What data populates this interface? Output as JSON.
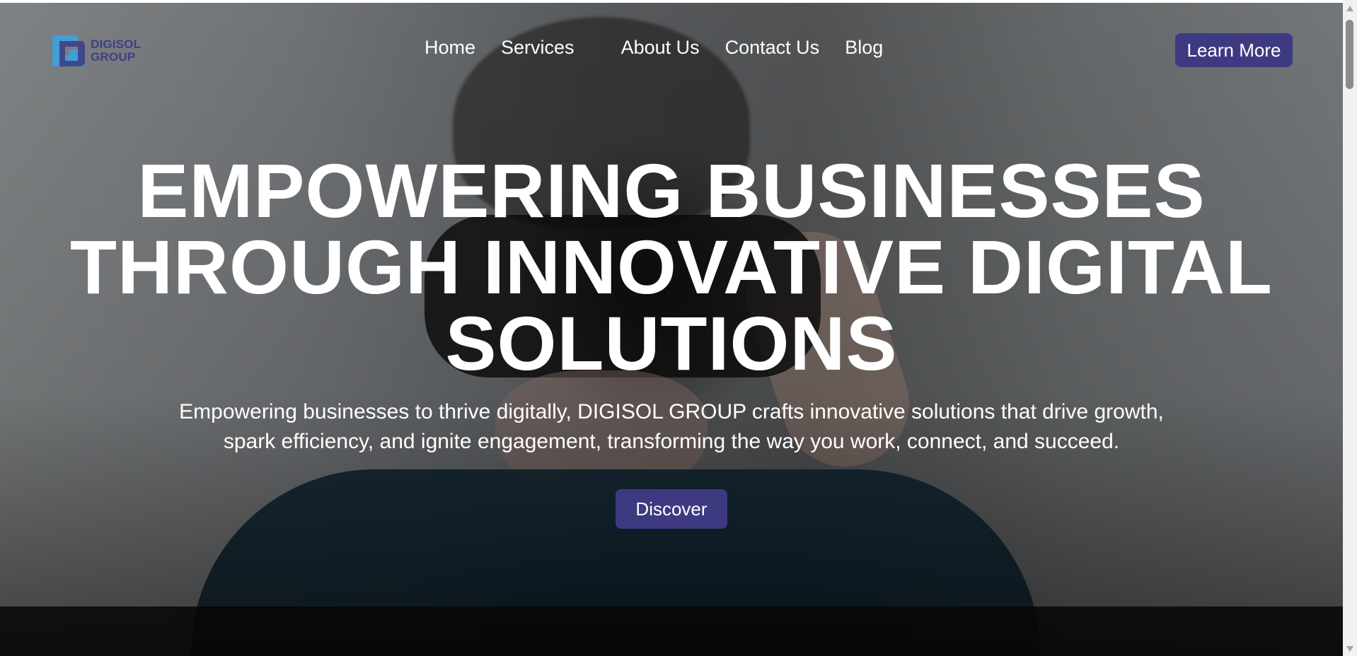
{
  "brand": {
    "line1": "DIGISOL",
    "line2": "GROUP",
    "color": "#3d3f86",
    "accent": "#3fa0d8"
  },
  "nav": {
    "items": [
      {
        "label": "Home"
      },
      {
        "label": "Services"
      },
      {
        "label": "About Us"
      },
      {
        "label": "Contact Us"
      },
      {
        "label": "Blog"
      }
    ],
    "cta_label": "Learn More"
  },
  "hero": {
    "title_line1": "EMPOWERING BUSINESSES",
    "title_line2": "THROUGH INNOVATIVE DIGITAL",
    "title_line3": "SOLUTIONS",
    "subtitle_line1": "Empowering businesses to thrive digitally, DIGISOL GROUP crafts innovative solutions that drive growth,",
    "subtitle_line2": "spark efficiency, and ignite engagement, transforming the way you work, connect, and succeed.",
    "cta_label": "Discover"
  },
  "colors": {
    "button": "#3e3a82",
    "text": "#ffffff"
  }
}
